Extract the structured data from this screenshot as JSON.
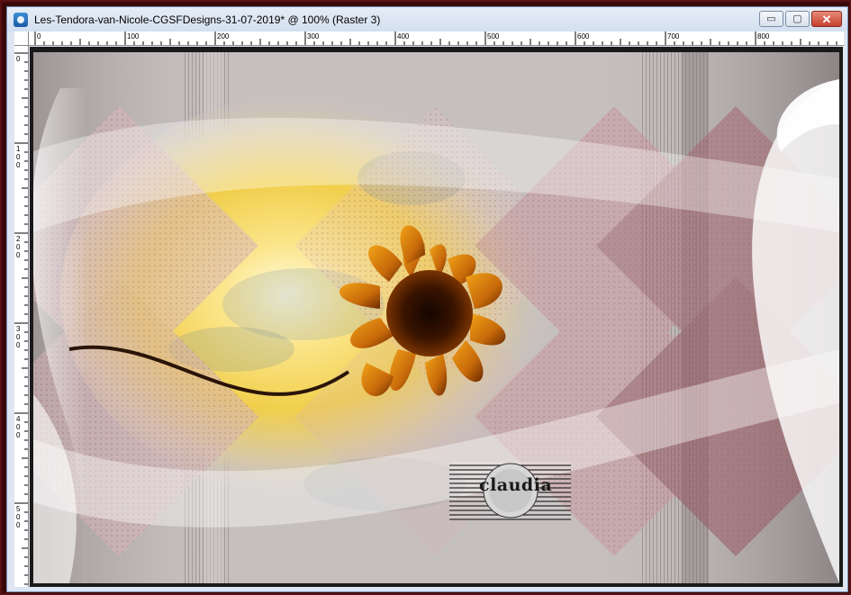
{
  "window": {
    "title": "Les-Tendora-van-Nicole-CGSFDesigns-31-07-2019* @ 100% (Raster 3)",
    "controls": {
      "minimize": "▭",
      "maximize": "▢",
      "close": "✕"
    }
  },
  "ruler": {
    "top_labels": [
      "0",
      "100",
      "200",
      "300",
      "400",
      "500",
      "600",
      "700",
      "800"
    ],
    "left_labels": [
      "0",
      "100",
      "200",
      "300",
      "400",
      "500"
    ]
  },
  "canvas": {
    "watermark_text": "claudia",
    "colors": {
      "sky_yellow": "#f6d24a",
      "flower_orange": "#c86a0a",
      "flower_dark": "#3a1400",
      "pink_diamond": "#c99aa0",
      "grey_bg": "#b9b1b1"
    }
  }
}
